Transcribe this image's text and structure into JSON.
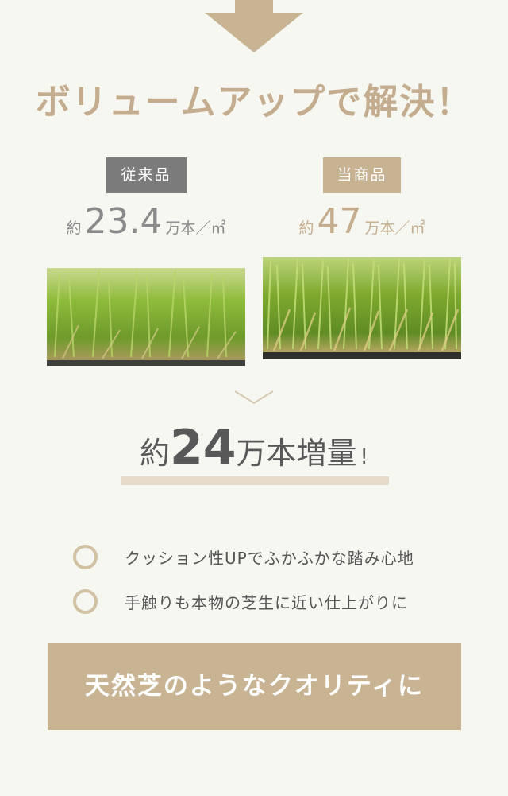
{
  "headline": "ボリュームアップで解決！",
  "comparison": {
    "conventional": {
      "badge": "従来品",
      "prefix": "約",
      "value": "23.4",
      "unit": "万本／㎡"
    },
    "ours": {
      "badge": "当商品",
      "prefix": "約",
      "value": "47",
      "unit": "万本／㎡"
    }
  },
  "increase": {
    "prefix": "約",
    "value": "24",
    "unit_word": "万本増量",
    "exclaim": "!"
  },
  "features": [
    "クッション性UPでふかふかな踏み心地",
    "手触りも本物の芝生に近い仕上がりに"
  ],
  "cta": {
    "label": "天然芝のようなクオリティに"
  },
  "colors": {
    "accent": "#c8b393",
    "gray_badge": "#7b7b7b",
    "background": "#f7f7f2"
  }
}
